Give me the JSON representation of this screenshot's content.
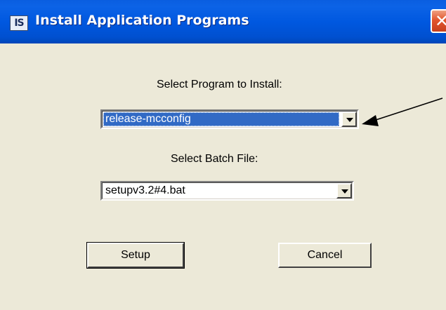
{
  "window": {
    "title": "Install Application Programs",
    "icon_text": "IS",
    "close_glyph": "✕"
  },
  "program_select": {
    "label": "Select Program to Install:",
    "value": "release-mcconfig",
    "focused": true
  },
  "batch_select": {
    "label": "Select Batch File:",
    "value": "setupv3.2#4.bat"
  },
  "buttons": {
    "setup_label": "Setup",
    "cancel_label": "Cancel"
  },
  "colors": {
    "titlebar": "#0058e0",
    "window_bg": "#ece9d8",
    "selection": "#316ac5",
    "close": "#e2562e"
  }
}
